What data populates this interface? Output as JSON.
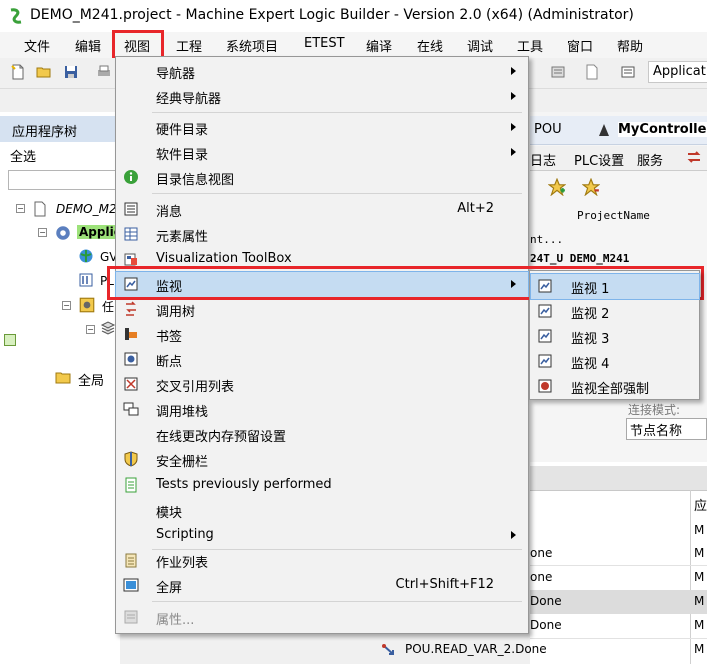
{
  "window": {
    "title": "DEMO_M241.project - Machine Expert Logic Builder - Version 2.0 (x64) (Administrator)"
  },
  "menubar": {
    "items": [
      {
        "label": "文件"
      },
      {
        "label": "编辑"
      },
      {
        "label": "视图"
      },
      {
        "label": "工程"
      },
      {
        "label": "系统项目"
      },
      {
        "label": "ETEST"
      },
      {
        "label": "编译"
      },
      {
        "label": "在线"
      },
      {
        "label": "调试"
      },
      {
        "label": "工具"
      },
      {
        "label": "窗口"
      },
      {
        "label": "帮助"
      }
    ],
    "active": "视图"
  },
  "toolbar": {
    "application_field": "Applicat"
  },
  "left_panel": {
    "title": "应用程序树",
    "select_all": "全选",
    "tree": [
      {
        "label": "DEMO_M2"
      },
      {
        "label": "Applic"
      },
      {
        "label": "GV"
      },
      {
        "label": "PL"
      },
      {
        "label": "任"
      },
      {
        "label": "全局"
      }
    ]
  },
  "right_panel": {
    "tabs_top": [
      {
        "label": "POU"
      },
      {
        "label": "MyController"
      }
    ],
    "tabs_second": [
      {
        "label": "日志"
      },
      {
        "label": "PLC设置"
      },
      {
        "label": "服务"
      }
    ],
    "code_lines": [
      "ProjectName",
      "nt...",
      "24T_U DEMO_M241"
    ],
    "connect_mode_label": "连接模式:",
    "node_name": "节点名称",
    "table_header": "应",
    "rows": [
      {
        "name": "one",
        "col": "M"
      },
      {
        "name": "one",
        "col": "M"
      },
      {
        "name": "Done",
        "col": "M"
      },
      {
        "name": "Done",
        "col": "M"
      },
      {
        "name": "POU.READ_VAR_2.Done",
        "col": "M"
      }
    ]
  },
  "dropdown": {
    "items": [
      {
        "label": "导航器",
        "submenu": true
      },
      {
        "label": "经典导航器",
        "submenu": true
      },
      {
        "label": "硬件目录",
        "submenu": true
      },
      {
        "label": "软件目录",
        "submenu": true
      },
      {
        "label": "目录信息视图",
        "icon": "info-icon"
      },
      {
        "label": "消息",
        "shortcut": "Alt+2",
        "icon": "message-list-icon"
      },
      {
        "label": "元素属性",
        "icon": "properties-grid-icon"
      },
      {
        "label": "Visualization ToolBox",
        "icon": "toolbox-icon"
      },
      {
        "label": "监视",
        "submenu": true,
        "highlighted": true,
        "icon": "watch-icon"
      },
      {
        "label": "调用树",
        "icon": "call-tree-icon"
      },
      {
        "label": "书签",
        "icon": "bookmark-icon"
      },
      {
        "label": "断点",
        "icon": "breakpoint-icon"
      },
      {
        "label": "交叉引用列表",
        "icon": "cross-reference-icon"
      },
      {
        "label": "调用堆栈",
        "icon": "call-stack-icon"
      },
      {
        "label": "在线更改内存预留设置"
      },
      {
        "label": "安全栅栏",
        "icon": "shield-icon"
      },
      {
        "label": "Tests previously performed",
        "icon": "test-doc-icon"
      },
      {
        "label": "模块"
      },
      {
        "label": "Scripting",
        "submenu": true
      },
      {
        "label": "作业列表",
        "icon": "task-list-icon"
      },
      {
        "label": "全屏",
        "shortcut": "Ctrl+Shift+F12",
        "icon": "fullscreen-icon"
      },
      {
        "label": "属性...",
        "disabled": true,
        "icon": "properties-icon"
      }
    ]
  },
  "submenu": {
    "items": [
      {
        "label": "监视 1",
        "highlighted": true
      },
      {
        "label": "监视 2"
      },
      {
        "label": "监视 3"
      },
      {
        "label": "监视 4"
      },
      {
        "label": "监视全部强制"
      }
    ]
  },
  "colors": {
    "highlight_box": "#e8262a",
    "menu_hover": "#c5dcf2",
    "panel_header": "#d6e2f1"
  }
}
